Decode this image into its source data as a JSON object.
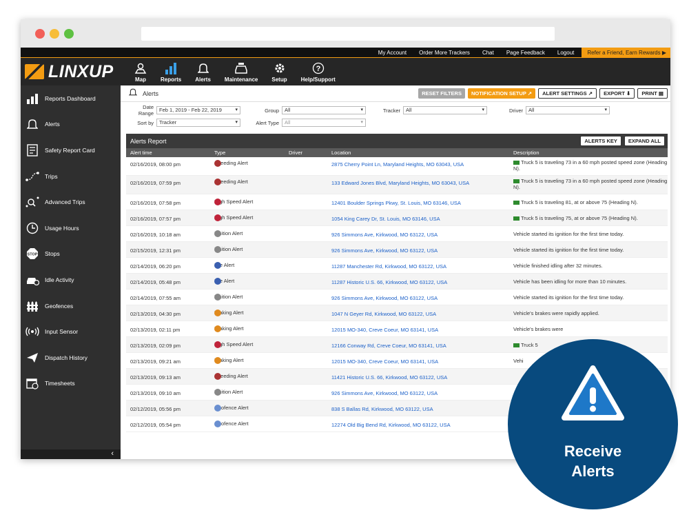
{
  "topbar": {
    "links": [
      "My Account",
      "Order More Trackers",
      "Chat",
      "Page Feedback",
      "Logout"
    ],
    "refer": "Refer a Friend, Earn Rewards ▶"
  },
  "brand": {
    "name": "LINXUP",
    "color": "#f39c12"
  },
  "nav": [
    {
      "label": "Map",
      "icon": "map-pin-icon"
    },
    {
      "label": "Reports",
      "icon": "bar-chart-icon"
    },
    {
      "label": "Alerts",
      "icon": "bell-icon"
    },
    {
      "label": "Maintenance",
      "icon": "car-repair-icon"
    },
    {
      "label": "Setup",
      "icon": "gear-icon"
    },
    {
      "label": "Help/Support",
      "icon": "question-icon"
    }
  ],
  "sidebar": [
    {
      "label": "Reports Dashboard",
      "icon": "bar-chart-icon"
    },
    {
      "label": "Alerts",
      "icon": "bell-icon"
    },
    {
      "label": "Safety Report Card",
      "icon": "report-card-icon"
    },
    {
      "label": "Trips",
      "icon": "trip-icon"
    },
    {
      "label": "Advanced Trips",
      "icon": "advanced-trip-icon"
    },
    {
      "label": "Usage Hours",
      "icon": "clock-icon"
    },
    {
      "label": "Stops",
      "icon": "stop-icon"
    },
    {
      "label": "Idle Activity",
      "icon": "idle-car-icon"
    },
    {
      "label": "Geofences",
      "icon": "fence-icon"
    },
    {
      "label": "Input Sensor",
      "icon": "sensor-icon"
    },
    {
      "label": "Dispatch History",
      "icon": "send-icon"
    },
    {
      "label": "Timesheets",
      "icon": "calendar-icon"
    }
  ],
  "sidebar_collapse": "‹",
  "page": {
    "title": "Alerts",
    "buttons": {
      "reset": "RESET FILTERS",
      "notification": "NOTIFICATION SETUP",
      "alert_settings": "ALERT SETTINGS",
      "export": "EXPORT",
      "print": "PRINT"
    }
  },
  "filters": {
    "date_range_label": "Date Range",
    "date_range_value": "Feb 1, 2019 - Feb 22, 2019",
    "group_label": "Group",
    "group_value": "All",
    "tracker_label": "Tracker",
    "tracker_value": "All",
    "driver_label": "Driver",
    "driver_value": "All",
    "sortby_label": "Sort by",
    "sortby_value": "Tracker",
    "alert_type_label": "Alert Type",
    "alert_type_value": "All"
  },
  "report": {
    "title": "Alerts Report",
    "key_button": "ALERTS KEY",
    "expand_button": "EXPAND ALL",
    "columns": [
      "Alert time",
      "Type",
      "Driver",
      "Location",
      "Description"
    ]
  },
  "rows": [
    {
      "time": "02/16/2019, 08:00 pm",
      "type": "Speeding Alert",
      "color": "#a33",
      "location": "2875 Cherry Point Ln, Maryland Heights, MO 63043, USA",
      "desc": "Truck 5 is traveling 73 in a 60 mph posted speed zone (Heading N).",
      "truck": true
    },
    {
      "time": "02/16/2019, 07:59 pm",
      "type": "Speeding Alert",
      "color": "#a33",
      "location": "133 Edward Jones Blvd, Maryland Heights, MO 63043, USA",
      "desc": "Truck 5 is traveling 73 in a 60 mph posted speed zone (Heading N).",
      "truck": true
    },
    {
      "time": "02/16/2019, 07:58 pm",
      "type": "High Speed Alert",
      "color": "#c0233a",
      "location": "12401 Boulder Springs Pkwy, St. Louis, MO 63146, USA",
      "desc": "Truck 5 is traveling 81, at or above 75 (Heading N).",
      "truck": true
    },
    {
      "time": "02/16/2019, 07:57 pm",
      "type": "High Speed Alert",
      "color": "#c0233a",
      "location": "1054 King Carey Dr, St. Louis, MO 63146, USA",
      "desc": "Truck 5 is traveling 75, at or above 75 (Heading N).",
      "truck": true
    },
    {
      "time": "02/16/2019, 10:18 am",
      "type": "Ignition Alert",
      "color": "#888",
      "location": "926 Simmons Ave, Kirkwood, MO 63122, USA",
      "desc": "Vehicle started its ignition for the first time today.",
      "truck": false
    },
    {
      "time": "02/15/2019, 12:31 pm",
      "type": "Ignition Alert",
      "color": "#888",
      "location": "926 Simmons Ave, Kirkwood, MO 63122, USA",
      "desc": "Vehicle started its ignition for the first time today.",
      "truck": false
    },
    {
      "time": "02/14/2019, 06:20 pm",
      "type": "Idle Alert",
      "color": "#3a5fb0",
      "location": "11287 Manchester Rd, Kirkwood, MO 63122, USA",
      "desc": "Vehicle finished idling after 32 minutes.",
      "truck": false
    },
    {
      "time": "02/14/2019, 05:48 pm",
      "type": "Idle Alert",
      "color": "#3a5fb0",
      "location": "11287 Historic U.S. 66, Kirkwood, MO 63122, USA",
      "desc": "Vehicle has been idling for more than 10 minutes.",
      "truck": false
    },
    {
      "time": "02/14/2019, 07:55 am",
      "type": "Ignition Alert",
      "color": "#888",
      "location": "926 Simmons Ave, Kirkwood, MO 63122, USA",
      "desc": "Vehicle started its ignition for the first time today.",
      "truck": false
    },
    {
      "time": "02/13/2019, 04:30 pm",
      "type": "Braking Alert",
      "color": "#e08a1e",
      "location": "1047 N Geyer Rd, Kirkwood, MO 63122, USA",
      "desc": "Vehicle's brakes were rapidly applied.",
      "truck": false
    },
    {
      "time": "02/13/2019, 02:11 pm",
      "type": "Braking Alert",
      "color": "#e08a1e",
      "location": "12015 MO-340, Creve Coeur, MO 63141, USA",
      "desc": "Vehicle's brakes were",
      "truck": false
    },
    {
      "time": "02/13/2019, 02:09 pm",
      "type": "High Speed Alert",
      "color": "#c0233a",
      "location": "12166 Conway Rd, Creve Coeur, MO 63141, USA",
      "desc": "Truck 5",
      "truck": true
    },
    {
      "time": "02/13/2019, 09:21 am",
      "type": "Braking Alert",
      "color": "#e08a1e",
      "location": "12015 MO-340, Creve Coeur, MO 63141, USA",
      "desc": "Vehi",
      "truck": false
    },
    {
      "time": "02/13/2019, 09:13 am",
      "type": "Speeding Alert",
      "color": "#a33",
      "location": "11421 Historic U.S. 66, Kirkwood, MO 63122, USA",
      "desc": "",
      "truck": false
    },
    {
      "time": "02/13/2019, 09:10 am",
      "type": "Ignition Alert",
      "color": "#888",
      "location": "926 Simmons Ave, Kirkwood, MO 63122, USA",
      "desc": "",
      "truck": false
    },
    {
      "time": "02/12/2019, 05:56 pm",
      "type": "Geofence Alert",
      "color": "#6a8fd0",
      "location": "838 S Ballas Rd, Kirkwood, MO 63122, USA",
      "desc": "",
      "truck": false
    },
    {
      "time": "02/12/2019, 05:54 pm",
      "type": "Geofence Alert",
      "color": "#6a8fd0",
      "location": "12274 Old Big Bend Rd, Kirkwood, MO 63122, USA",
      "desc": "",
      "truck": false
    }
  ],
  "callout": {
    "line1": "Receive",
    "line2": "Alerts",
    "color": "#084a7e"
  }
}
